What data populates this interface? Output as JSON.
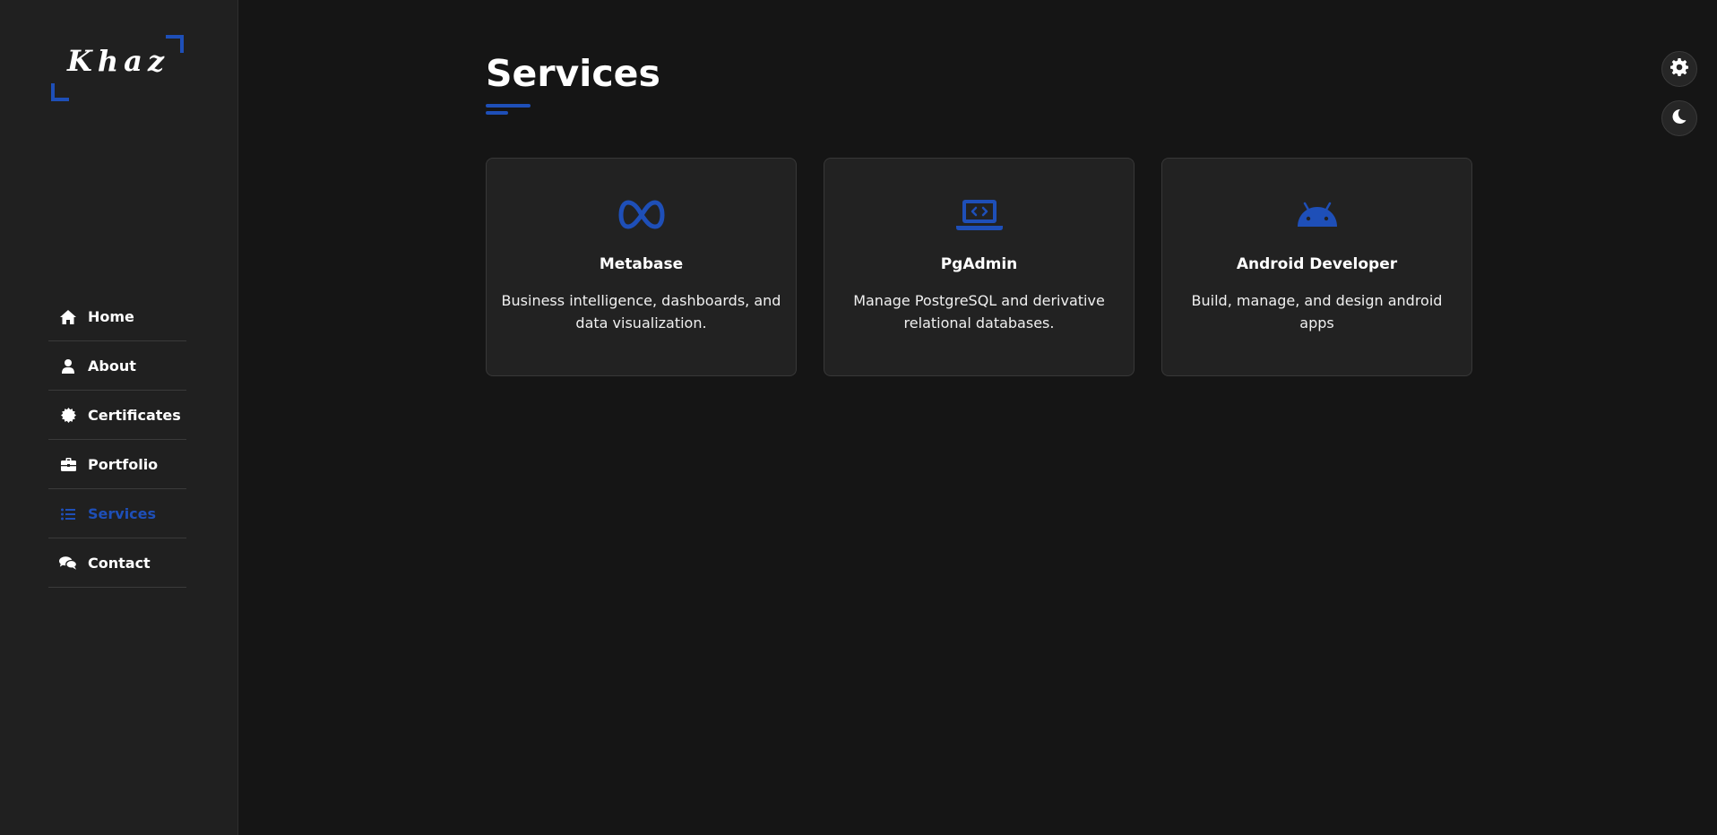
{
  "sidebar": {
    "logo_text": "Khaz",
    "nav": [
      {
        "label": "Home",
        "icon": "home-icon",
        "active": false
      },
      {
        "label": "About",
        "icon": "user-icon",
        "active": false
      },
      {
        "label": "Certificates",
        "icon": "certificate-icon",
        "active": false
      },
      {
        "label": "Portfolio",
        "icon": "briefcase-icon",
        "active": false
      },
      {
        "label": "Services",
        "icon": "list-icon",
        "active": true
      },
      {
        "label": "Contact",
        "icon": "chat-icon",
        "active": false
      }
    ]
  },
  "main": {
    "title": "Services",
    "services": [
      {
        "title": "Metabase",
        "description": "Business intelligence, dashboards, and data visualization.",
        "icon": "meta-infinity-icon"
      },
      {
        "title": "PgAdmin",
        "description": "Manage PostgreSQL and derivative relational databases.",
        "icon": "laptop-code-icon"
      },
      {
        "title": "Android Developer",
        "description": "Build, manage, and design android apps",
        "icon": "android-icon"
      }
    ]
  },
  "controls": {
    "settings_icon": "gear-icon",
    "theme_icon": "moon-icon"
  },
  "colors": {
    "accent": "#1e4fb8",
    "background": "#151515",
    "sidebar": "#202020",
    "card": "#222222"
  }
}
